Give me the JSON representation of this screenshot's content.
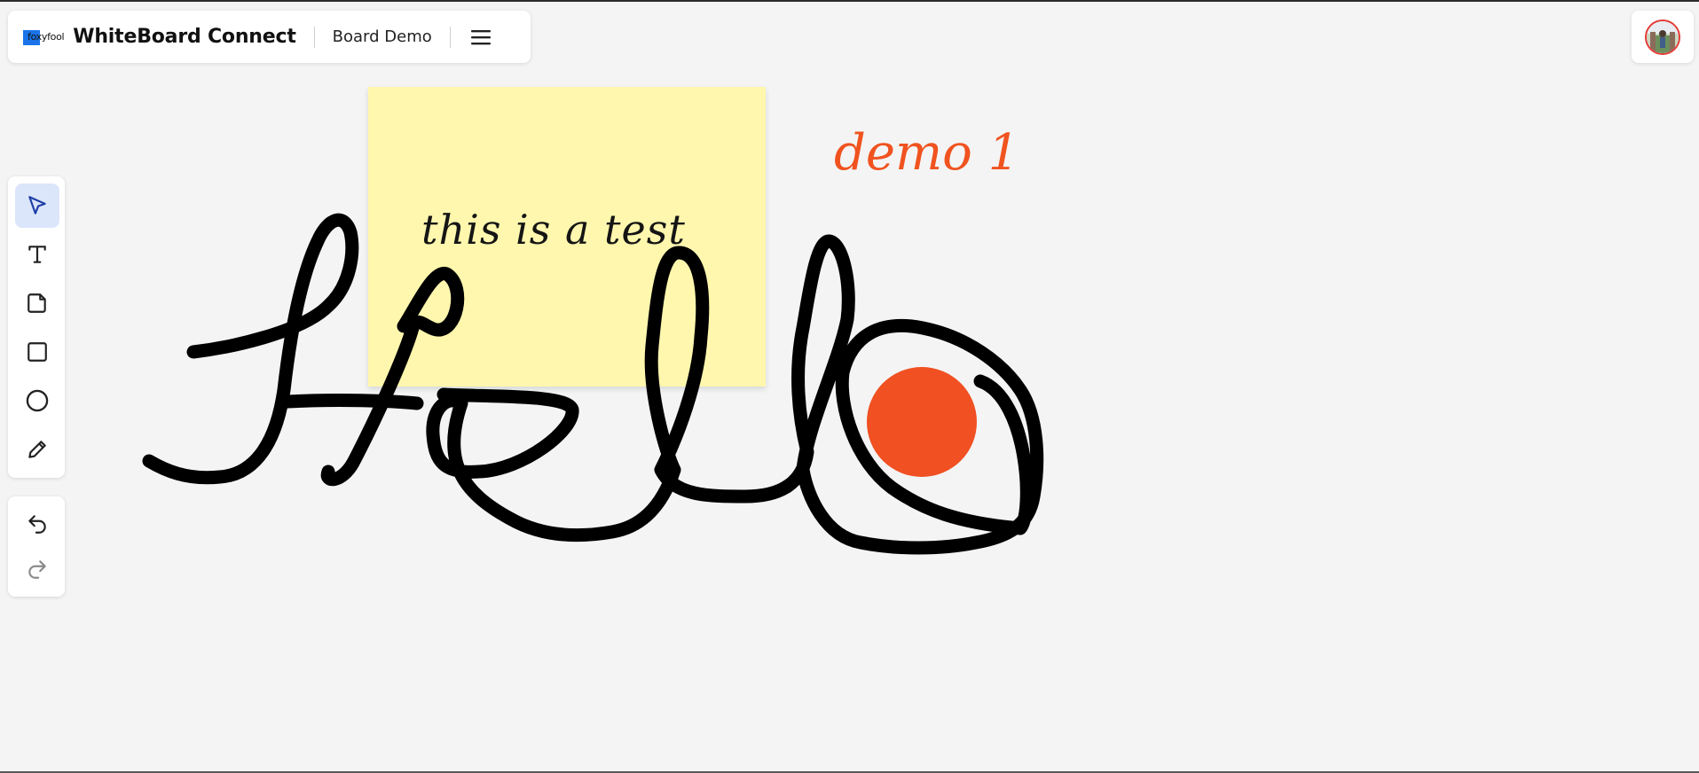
{
  "header": {
    "logo_text": "foxyfool",
    "app_title": "WhiteBoard Connect",
    "board_name": "Board Demo",
    "menu_icon": "hamburger-menu-icon"
  },
  "user": {
    "avatar_icon": "user-avatar-icon",
    "avatar_border_color": "#e53935"
  },
  "toolbar": {
    "tools": [
      {
        "name": "select",
        "icon": "cursor-arrow-icon",
        "active": true
      },
      {
        "name": "text",
        "icon": "text-tool-icon",
        "active": false
      },
      {
        "name": "sticky-note",
        "icon": "sticky-note-icon",
        "active": false
      },
      {
        "name": "rectangle",
        "icon": "square-icon",
        "active": false
      },
      {
        "name": "circle",
        "icon": "circle-icon",
        "active": false
      },
      {
        "name": "pen",
        "icon": "pencil-icon",
        "active": false
      }
    ],
    "history": [
      {
        "name": "undo",
        "icon": "undo-icon",
        "enabled": true
      },
      {
        "name": "redo",
        "icon": "redo-icon",
        "enabled": false
      }
    ]
  },
  "board": {
    "sticky_note": {
      "text": "this is a test",
      "color": "#fff7ae"
    },
    "text_item": {
      "text": "demo 1",
      "color": "#f0531f"
    },
    "circle_shape": {
      "color": "#f05022"
    },
    "drawing": {
      "description": "freehand stroke",
      "color": "#000000"
    }
  },
  "colors": {
    "accent": "#1a73e8",
    "active_tool_bg": "#dbe6fb",
    "canvas_bg": "#f4f4f4"
  }
}
